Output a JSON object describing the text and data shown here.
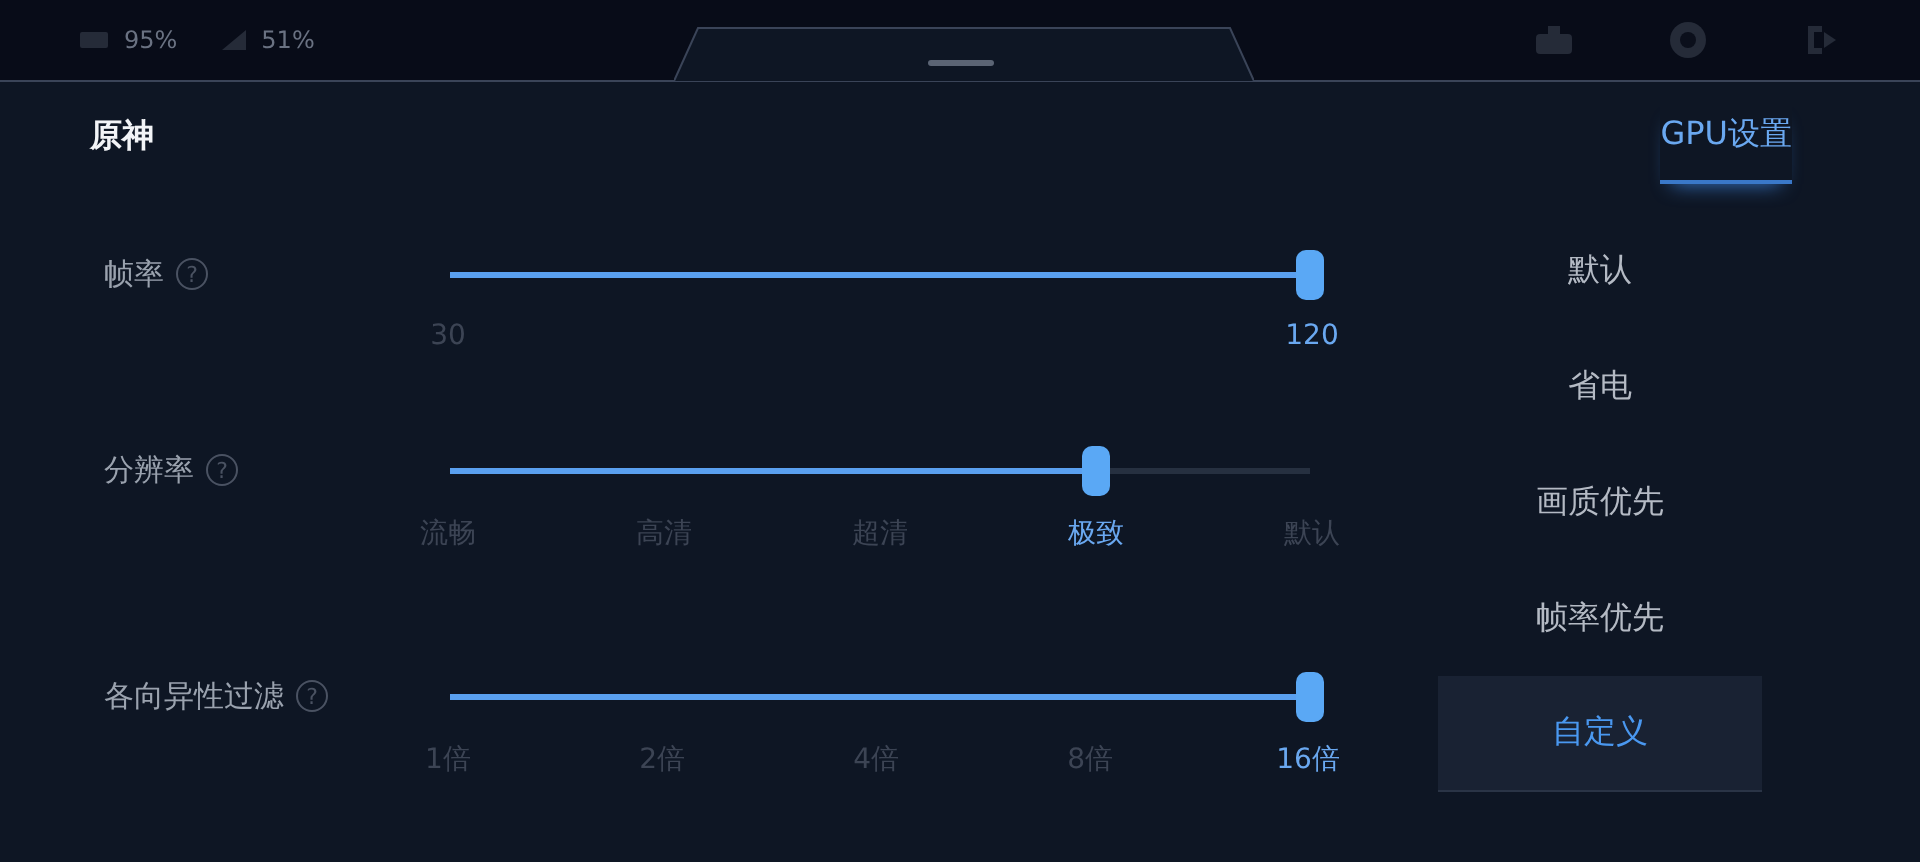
{
  "status_bar": {
    "items": [
      "95%",
      "51%"
    ]
  },
  "header": {
    "title": "原神",
    "tab": {
      "label": "GPU设置",
      "selected": true
    }
  },
  "sliders": [
    {
      "label": "帧率",
      "hint": "?",
      "level": 1,
      "ticks": [
        {
          "label": "30",
          "selected": false
        },
        {
          "label": "120",
          "selected": true
        }
      ]
    },
    {
      "label": "分辨率",
      "hint": "?",
      "level": 0.75,
      "ticks": [
        {
          "label": "流畅",
          "selected": false
        },
        {
          "label": "高清",
          "selected": false
        },
        {
          "label": "超清",
          "selected": false
        },
        {
          "label": "极致",
          "selected": true
        },
        {
          "label": "默认",
          "selected": false
        }
      ]
    },
    {
      "label": "各向异性过滤",
      "hint": "?",
      "level": 1,
      "ticks": [
        {
          "label": "1倍",
          "selected": false
        },
        {
          "label": "2倍",
          "selected": false
        },
        {
          "label": "4倍",
          "selected": false
        },
        {
          "label": "8倍",
          "selected": false
        },
        {
          "label": "16倍",
          "selected": true
        }
      ]
    }
  ],
  "presets": [
    {
      "label": "默认",
      "selected": false
    },
    {
      "label": "省电",
      "selected": false
    },
    {
      "label": "画质优先",
      "selected": false
    },
    {
      "label": "帧率优先",
      "selected": false
    },
    {
      "label": "自定义",
      "selected": true
    }
  ]
}
